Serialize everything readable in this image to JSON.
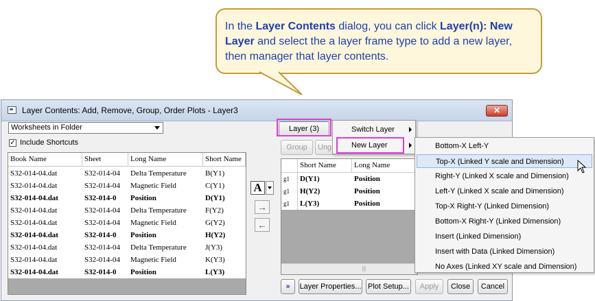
{
  "callout": {
    "t1": "In the ",
    "b1": "Layer Contents",
    "t2": " dialog, you can click ",
    "b2": "Layer(n): New Layer",
    "t3": " and select the a layer frame type to add a new layer, then manager that layer contents."
  },
  "dialog": {
    "title": "Layer Contents: Add, Remove, Group, Order Plots - Layer3",
    "close": "✕",
    "source_select": "Worksheets in Folder",
    "include_shortcuts": "Include Shortcuts",
    "include_shortcuts_checked": true,
    "left_table": {
      "columns": [
        "Book Name",
        "Sheet",
        "Long Name",
        "Short Name"
      ],
      "rows": [
        {
          "book": "S32-014-04.dat",
          "sheet": "S32-014-04",
          "long": "Delta Temperature",
          "short": "B(Y1)",
          "bold": false
        },
        {
          "book": "S32-014-04.dat",
          "sheet": "S32-014-04",
          "long": "Magnetic Field",
          "short": "C(Y1)",
          "bold": false
        },
        {
          "book": "S32-014-04.dat",
          "sheet": "S32-014-0",
          "long": "Position",
          "short": "D(Y1)",
          "bold": true
        },
        {
          "book": "S32-014-04.dat",
          "sheet": "S32-014-04",
          "long": "Delta Temperature",
          "short": "F(Y2)",
          "bold": false
        },
        {
          "book": "S32-014-04.dat",
          "sheet": "S32-014-04",
          "long": "Magnetic Field",
          "short": "G(Y2)",
          "bold": false
        },
        {
          "book": "S32-014-04.dat",
          "sheet": "S32-014-0",
          "long": "Position",
          "short": "H(Y2)",
          "bold": true
        },
        {
          "book": "S32-014-04.dat",
          "sheet": "S32-014-04",
          "long": "Delta Temperature",
          "short": "J(Y3)",
          "bold": false
        },
        {
          "book": "S32-014-04.dat",
          "sheet": "S32-014-04",
          "long": "Magnetic Field",
          "short": "K(Y3)",
          "bold": false
        },
        {
          "book": "S32-014-04.dat",
          "sheet": "S32-014-0",
          "long": "Position",
          "short": "L(Y3)",
          "bold": true
        }
      ]
    },
    "a_button": "A",
    "layer_button": "Layer (3)",
    "group_button": "Group",
    "ungroup_button": "Ung",
    "right_table": {
      "columns": [
        "Short Name",
        "Long Name"
      ],
      "rows": [
        {
          "g": "g1",
          "short": "D(Y1)",
          "long": "Position"
        },
        {
          "g": "g1",
          "short": "H(Y2)",
          "long": "Position"
        },
        {
          "g": "g1",
          "short": "L(Y3)",
          "long": "Position"
        }
      ]
    },
    "bottom": {
      "expand": "»",
      "layer_properties": "Layer Properties...",
      "plot_setup": "Plot Setup...",
      "apply": "Apply",
      "close": "Close",
      "cancel": "Cancel"
    }
  },
  "layer_menu": {
    "items": [
      "Switch Layer",
      "New Layer"
    ]
  },
  "new_layer_submenu": {
    "items": [
      "Bottom-X Left-Y",
      "Top-X (Linked Y scale and Dimension)",
      "Right-Y (Linked X scale and Dimension)",
      "Left-Y (Linked X scale and Dimension)",
      "Top-X Right-Y (Linked Dimension)",
      "Bottom-X Right-Y (Linked Dimension)",
      "Insert (Linked Dimension)",
      "Insert with Data (Linked Dimension)",
      "No Axes (Linked XY scale and Dimension)"
    ],
    "selected": "Top-X (Linked Y scale and Dimension)"
  },
  "colors": {
    "callout_bg": "#fef7dc",
    "callout_border": "#c49a3a",
    "callout_text": "#1f3fb0",
    "highlight": "#e13ad6"
  }
}
